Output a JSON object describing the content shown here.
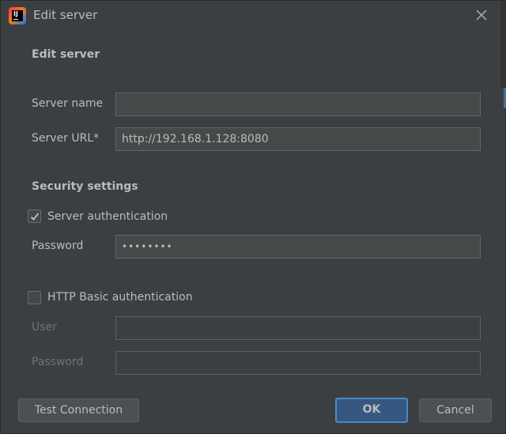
{
  "window": {
    "title": "Edit server",
    "icon": "intellij-idea-icon"
  },
  "form": {
    "section_title": "Edit server",
    "server_name": {
      "label": "Server name",
      "value": ""
    },
    "server_url": {
      "label": "Server URL*",
      "value": "http://192.168.1.128:8080"
    },
    "security": {
      "title": "Security settings",
      "server_auth": {
        "label": "Server authentication",
        "checked": true
      },
      "password": {
        "label": "Password",
        "value": "••••••••"
      },
      "http_basic": {
        "label": "HTTP Basic authentication",
        "checked": false
      },
      "user": {
        "label": "User",
        "value": ""
      },
      "basic_password": {
        "label": "Password",
        "value": ""
      }
    }
  },
  "buttons": {
    "test_connection": "Test Connection",
    "ok": "OK",
    "cancel": "Cancel"
  },
  "colors": {
    "background": "#3c3f41",
    "field_bg": "#45494a",
    "primary_button": "#365880",
    "primary_border": "#4a88c7"
  }
}
